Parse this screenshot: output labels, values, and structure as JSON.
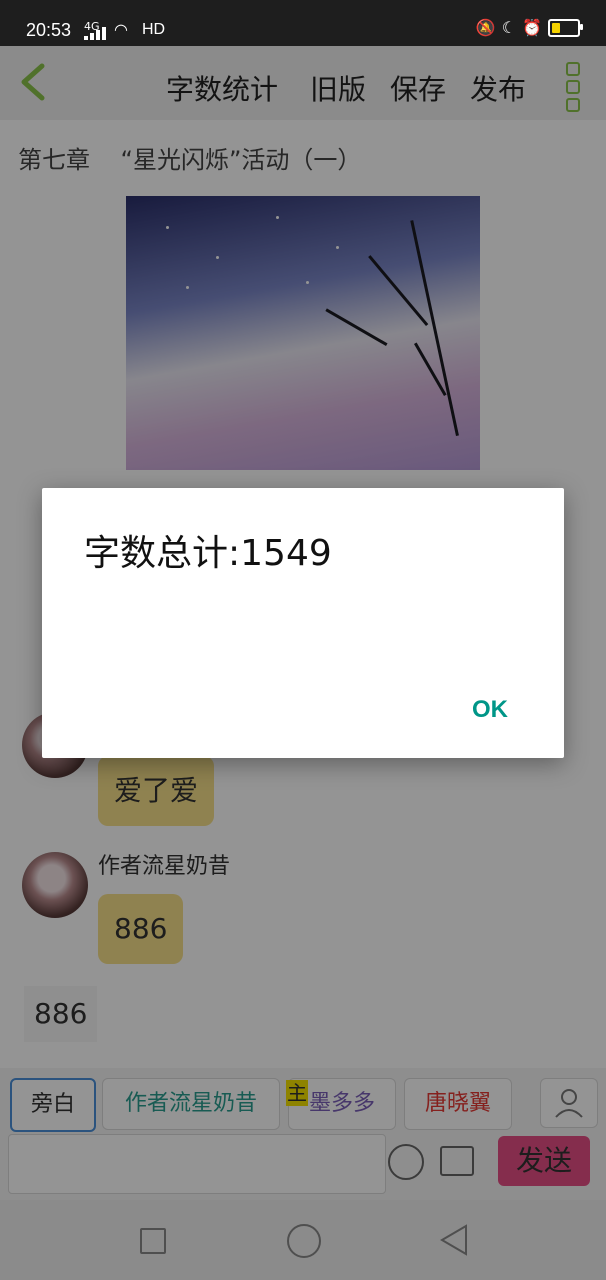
{
  "status_bar": {
    "time": "20:53",
    "network": "4G",
    "hd_label": "HD",
    "battery_color": "#f5d200"
  },
  "toolbar": {
    "back_icon": "chevron-left-icon",
    "items": [
      "字数统计",
      "旧版",
      "保存",
      "发布"
    ],
    "more_icon": "more-vertical-icon",
    "accent": "#8bc34a"
  },
  "chapter": {
    "title": "第七章    “星光闪烁”活动（一）"
  },
  "messages": [
    {
      "sender": "",
      "text": "爱了爱"
    },
    {
      "sender": "作者流星奶昔",
      "text": "886"
    }
  ],
  "narration_text": "886",
  "roles": {
    "narration": "旁白",
    "author": "作者流星奶昔",
    "role_moduo": "墨多多",
    "role_moduo_tag": "主",
    "role_tang": "唐晓翼"
  },
  "composer": {
    "input_value": "",
    "emoji_icon": "smiley-icon",
    "image_icon": "image-icon",
    "send_label": "发送",
    "send_color": "#e64e86"
  },
  "dialog": {
    "message": "字数总计:1549",
    "ok_label": "OK",
    "ok_color": "#009688"
  }
}
